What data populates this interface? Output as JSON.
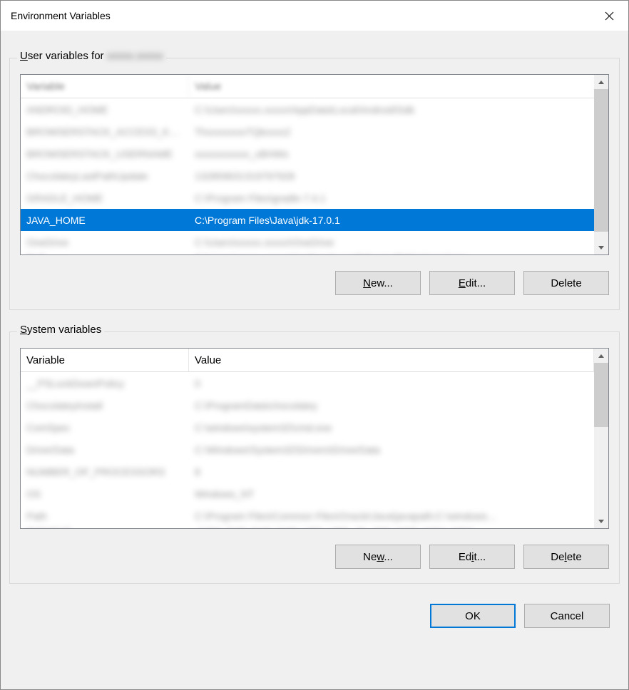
{
  "window": {
    "title": "Environment Variables"
  },
  "userSection": {
    "legendPrefix": "User variables for",
    "legendUser": "xxxxx.xxxxx",
    "header": {
      "variable": "Variable",
      "value": "Value"
    },
    "rows": [
      {
        "variable": "ANDROID_HOME",
        "value": "C:\\Users\\xxxxx.xxxxx\\AppData\\Local\\Android\\Sdk",
        "blurred": true
      },
      {
        "variable": "BROWSERSTACK_ACCESS_K…",
        "value": "ThxxxxxxxxTQkxxxx2",
        "blurred": true
      },
      {
        "variable": "BROWSERSTACK_USERNAME",
        "value": "xxxxxxxxxxx_xBHWs",
        "blurred": true
      },
      {
        "variable": "ChocolateyLastPathUpdate",
        "value": "132859631319797928",
        "blurred": true
      },
      {
        "variable": "GRADLE_HOME",
        "value": "C:\\Program Files\\gradle-7.4.1",
        "blurred": true
      },
      {
        "variable": "JAVA_HOME",
        "value": "C:\\Program Files\\Java\\jdk-17.0.1",
        "blurred": false,
        "selected": true
      },
      {
        "variable": "OneDrive",
        "value": "C:\\Users\\xxxxx.xxxxx\\OneDrive",
        "blurred": true
      },
      {
        "variable": "Path",
        "value": "C:\\Users\\xxxxx.xxxxx\\AppData\\Local\\Microsoft\\WindowsApps;…",
        "blurred": true
      }
    ],
    "buttons": {
      "new": "New...",
      "edit": "Edit...",
      "delete": "Delete"
    }
  },
  "systemSection": {
    "legend": "System variables",
    "header": {
      "variable": "Variable",
      "value": "Value"
    },
    "rows": [
      {
        "variable": "__PSLockDownPolicy",
        "value": "0",
        "blurred": true
      },
      {
        "variable": "ChocolateyInstall",
        "value": "C:\\ProgramData\\chocolatey",
        "blurred": true
      },
      {
        "variable": "ComSpec",
        "value": "C:\\windows\\system32\\cmd.exe",
        "blurred": true
      },
      {
        "variable": "DriverData",
        "value": "C:\\Windows\\System32\\Drivers\\DriverData",
        "blurred": true
      },
      {
        "variable": "NUMBER_OF_PROCESSORS",
        "value": "8",
        "blurred": true
      },
      {
        "variable": "OS",
        "value": "Windows_NT",
        "blurred": true
      },
      {
        "variable": "Path",
        "value": "C:\\Program Files\\Common Files\\Oracle\\Java\\javapath;C:\\windows…",
        "blurred": true
      },
      {
        "variable": "PATHEXT",
        "value": ".COM;.EXE;.BAT;.CMD;.VBS;.VBE;.JS;.JSE;.WSF;.WSH;.MSC",
        "blurred": true
      }
    ],
    "buttons": {
      "new": "New...",
      "edit": "Edit...",
      "delete": "Delete"
    }
  },
  "dialogButtons": {
    "ok": "OK",
    "cancel": "Cancel"
  }
}
